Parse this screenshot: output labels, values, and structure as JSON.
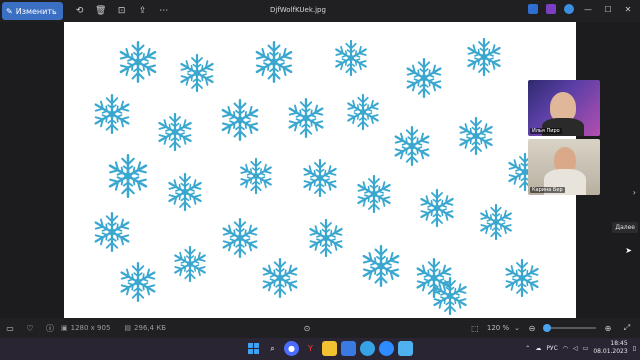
{
  "toolbar": {
    "edit_label": "Изменить",
    "filename": "DjfWolfKUek.jpg",
    "icons": [
      "pencil-icon",
      "rotate-icon",
      "delete-icon",
      "crop-icon",
      "share-icon",
      "more-icon"
    ]
  },
  "window": {
    "controls": [
      "minimize",
      "maximize",
      "close"
    ]
  },
  "image": {
    "flake_color": "#3aa7cf",
    "background": "#ffffff"
  },
  "video_tiles": [
    {
      "label": "Илья Пиро",
      "background_hint": "act plan"
    },
    {
      "label": "Карина Бер"
    }
  ],
  "navigation": {
    "next_tooltip": "Далее"
  },
  "statusbar": {
    "dimensions": "1280 x 905",
    "file_size": "296,4 КБ",
    "zoom": "120 %",
    "zoom_level_fraction": 0.06
  },
  "taskbar": {
    "language": "РУС",
    "time": "18:45",
    "date": "08.01.2023"
  }
}
